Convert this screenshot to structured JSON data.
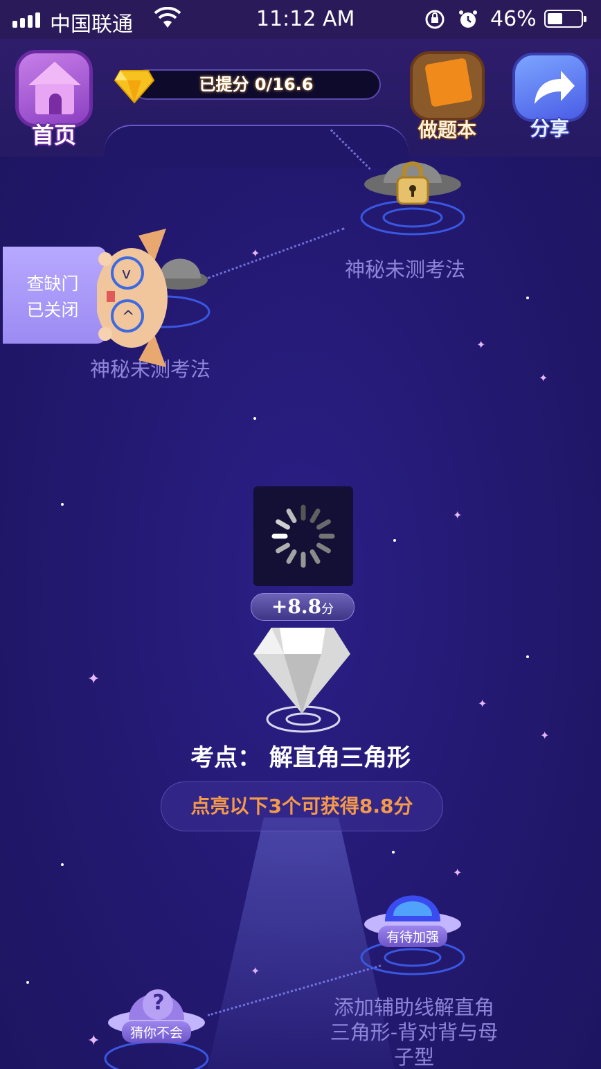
{
  "status_bar": {
    "carrier": "中国联通",
    "time": "11:12 AM",
    "battery_percent": "46%",
    "battery_level": 0.46,
    "icons": [
      "signal-icon",
      "wifi-icon",
      "orientation-lock-icon",
      "alarm-icon",
      "battery-icon"
    ]
  },
  "header": {
    "home_label": "首页",
    "score_text": "已提分 0/16.6",
    "notebook_label": "做题本",
    "share_label": "分享"
  },
  "side_tab": {
    "line1": "查缺门",
    "line2": "已关闭"
  },
  "nodes": {
    "locked_top_label": "神秘未测考法",
    "locked_left_label": "神秘未测考法",
    "main_points": "+8.8",
    "main_points_unit": "分",
    "main_title": "考点：  解直角三角形",
    "main_hint": "点亮以下3个可获得8.8分",
    "node_right_badge": "有待加强",
    "node_right_label_line1": "添加辅助线解直角",
    "node_right_label_line2": "三角形-背对背与母",
    "node_right_label_line3": "子型",
    "node_left_badge": "猜你不会",
    "node_left_glyph": "?"
  },
  "colors": {
    "background": "#231a6b",
    "hint_text": "#f59a4a",
    "node_label": "#8d86d9"
  }
}
